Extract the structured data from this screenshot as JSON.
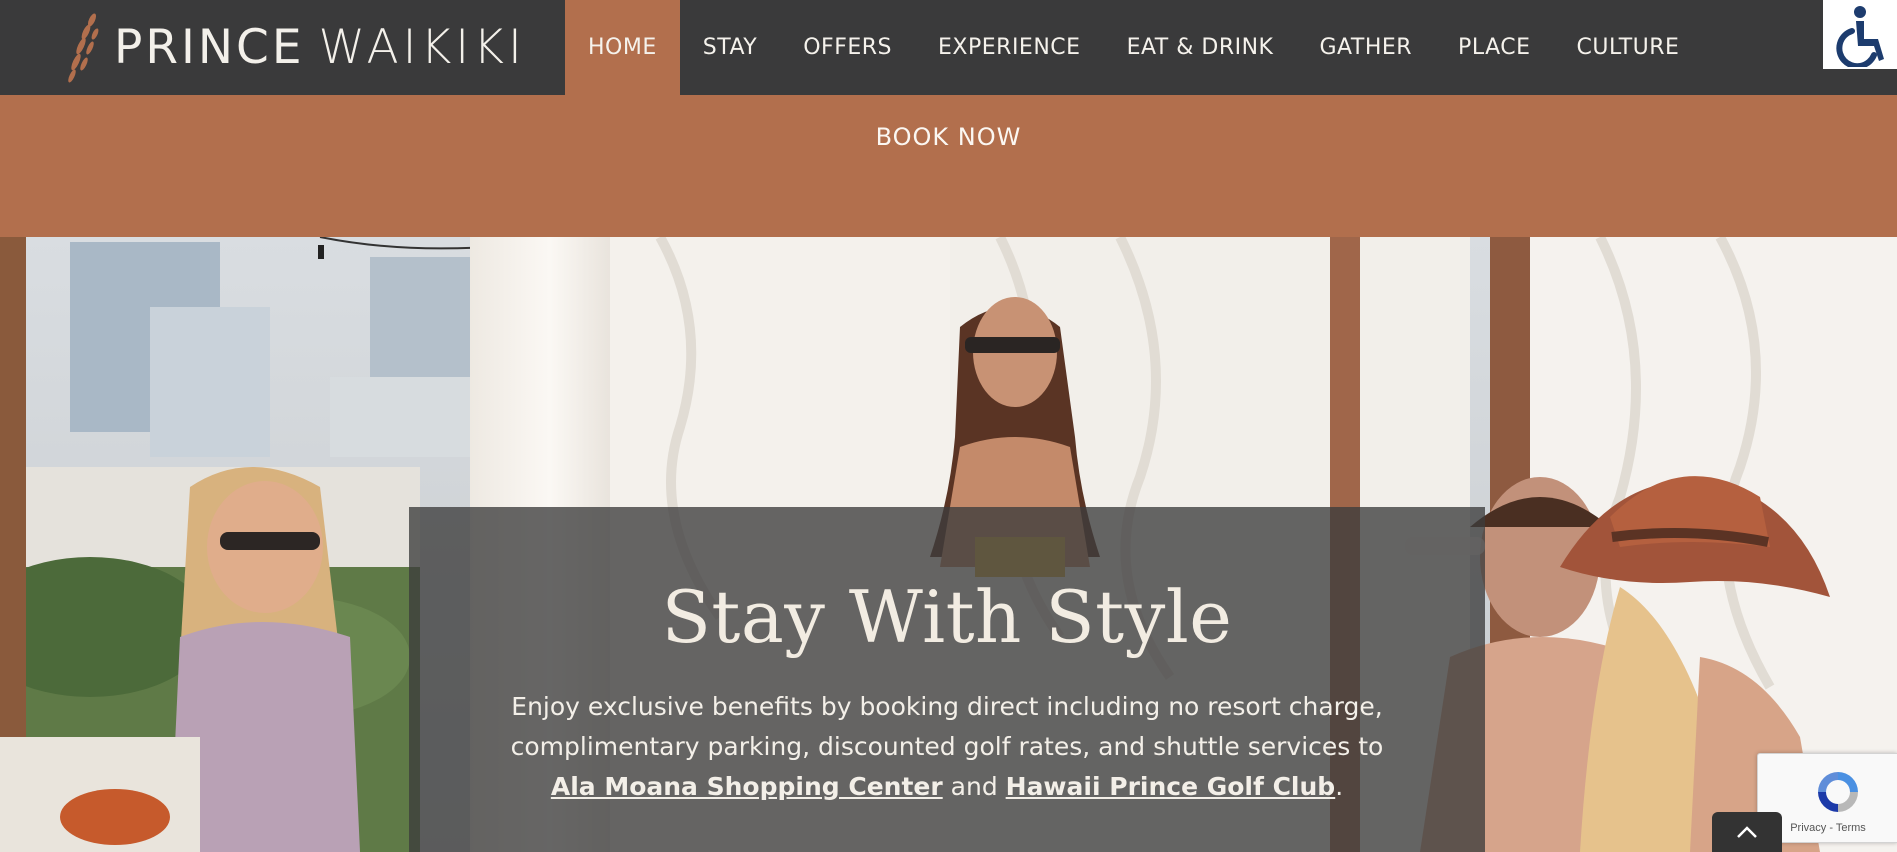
{
  "brand": {
    "name_part1": "PRINCE",
    "name_part2": "WAIKIKI",
    "accent_color": "#b26f4d",
    "header_color": "#3a3a3b"
  },
  "nav": {
    "items": [
      {
        "label": "HOME",
        "active": true
      },
      {
        "label": "STAY",
        "active": false
      },
      {
        "label": "OFFERS",
        "active": false
      },
      {
        "label": "EXPERIENCE",
        "active": false
      },
      {
        "label": "EAT & DRINK",
        "active": false
      },
      {
        "label": "GATHER",
        "active": false
      },
      {
        "label": "PLACE",
        "active": false
      },
      {
        "label": "CULTURE",
        "active": false
      }
    ]
  },
  "accessibility": {
    "icon": "wheelchair-icon"
  },
  "booking": {
    "label": "BOOK NOW"
  },
  "hero": {
    "title": "Stay With Style",
    "text_before": "Enjoy exclusive benefits by booking direct including no resort charge, complimentary parking, discounted golf rates, and shuttle services to ",
    "link1": "Ala Moana Shopping Center",
    "text_middle": " and ",
    "link2": "Hawaii Prince Golf Club",
    "text_after": "."
  },
  "recaptcha": {
    "text": "Privacy - Terms",
    "icon": "recaptcha-icon"
  },
  "scroll_top": {
    "icon": "chevron-up-icon"
  }
}
